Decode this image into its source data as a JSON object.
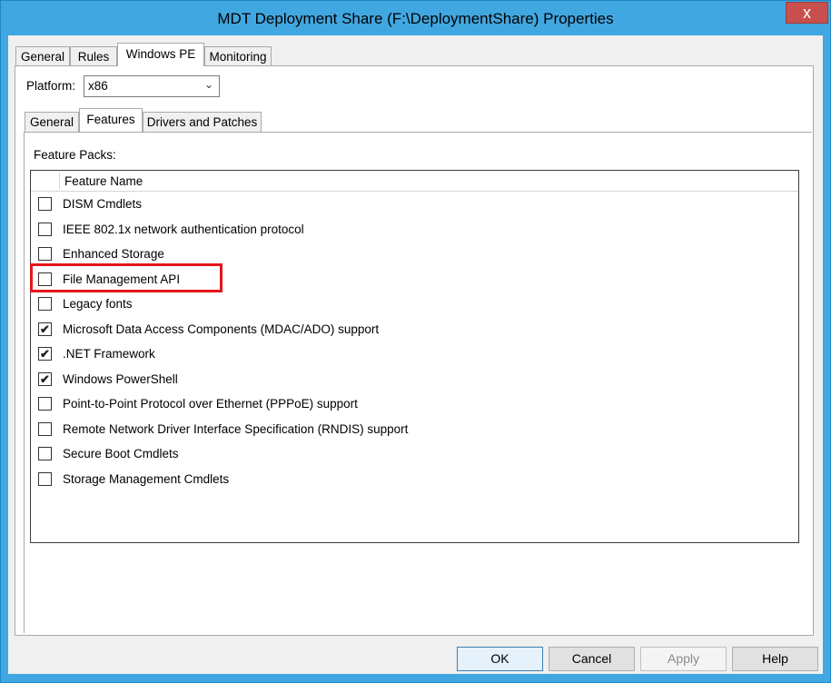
{
  "window": {
    "title": "MDT Deployment Share (F:\\DeploymentShare) Properties",
    "close_glyph": "x"
  },
  "tabs_outer": [
    {
      "label": "General"
    },
    {
      "label": "Rules"
    },
    {
      "label": "Windows PE",
      "selected": true
    },
    {
      "label": "Monitoring"
    }
  ],
  "platform": {
    "label": "Platform:",
    "value": "x86"
  },
  "tabs_inner": [
    {
      "label": "General"
    },
    {
      "label": "Features",
      "selected": true
    },
    {
      "label": "Drivers and Patches"
    }
  ],
  "feature_packs": {
    "label": "Feature Packs:",
    "column_header": "Feature Name",
    "items": [
      {
        "label": "DISM Cmdlets",
        "checked": false
      },
      {
        "label": "IEEE 802.1x network authentication protocol",
        "checked": false
      },
      {
        "label": "Enhanced Storage",
        "checked": false
      },
      {
        "label": "File Management API",
        "checked": false,
        "highlighted": true
      },
      {
        "label": "Legacy fonts",
        "checked": false
      },
      {
        "label": "Microsoft Data Access Components (MDAC/ADO) support",
        "checked": true
      },
      {
        "label": ".NET Framework",
        "checked": true
      },
      {
        "label": "Windows PowerShell",
        "checked": true
      },
      {
        "label": "Point-to-Point Protocol over Ethernet (PPPoE) support",
        "checked": false
      },
      {
        "label": "Remote Network Driver Interface Specification (RNDIS) support",
        "checked": false
      },
      {
        "label": "Secure Boot Cmdlets",
        "checked": false
      },
      {
        "label": "Storage Management Cmdlets",
        "checked": false
      }
    ]
  },
  "buttons": {
    "ok": "OK",
    "cancel": "Cancel",
    "apply": "Apply",
    "help": "Help"
  },
  "colors": {
    "highlight": "#e3161b",
    "titlebar": "#41a7e1",
    "close": "#c7504e"
  }
}
